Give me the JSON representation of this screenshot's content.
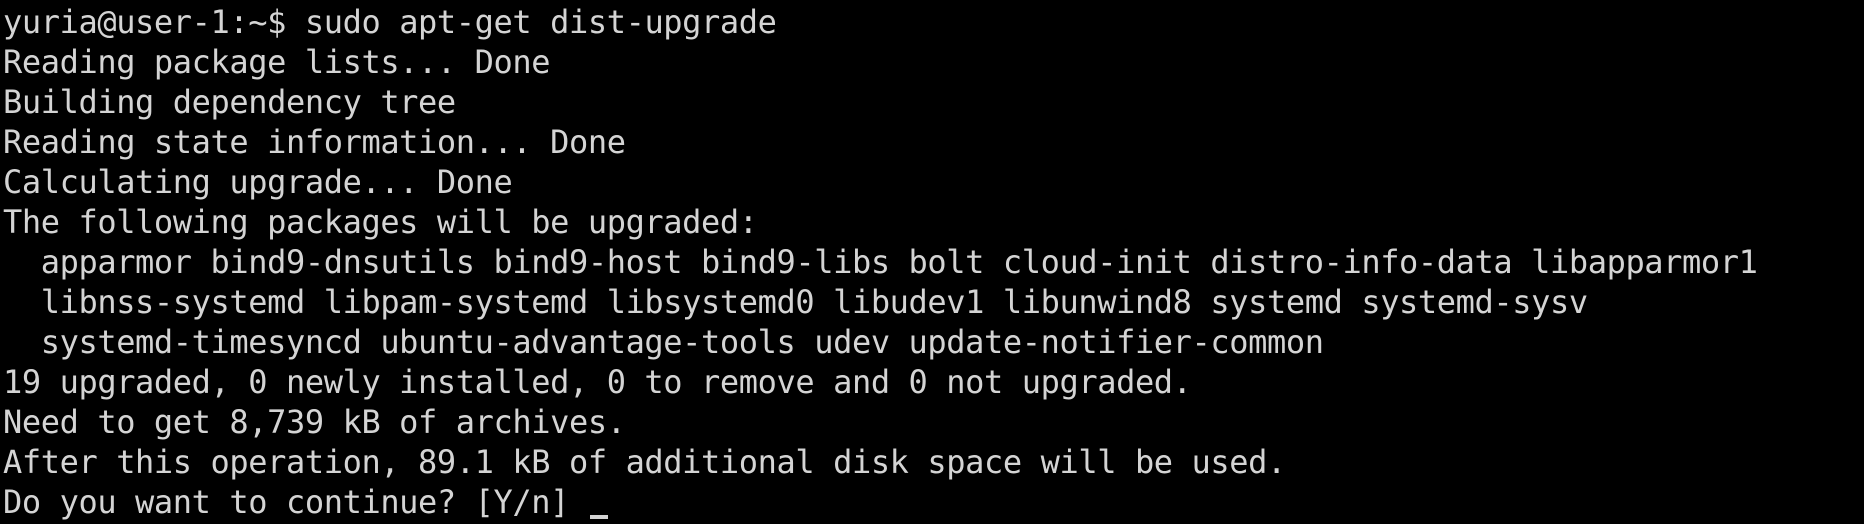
{
  "terminal": {
    "prompt": "yuria@user-1:~$ ",
    "command": "sudo apt-get dist-upgrade",
    "output": [
      "Reading package lists... Done",
      "Building dependency tree",
      "Reading state information... Done",
      "Calculating upgrade... Done",
      "The following packages will be upgraded:",
      "  apparmor bind9-dnsutils bind9-host bind9-libs bolt cloud-init distro-info-data libapparmor1",
      "  libnss-systemd libpam-systemd libsystemd0 libudev1 libunwind8 systemd systemd-sysv",
      "  systemd-timesyncd ubuntu-advantage-tools udev update-notifier-common",
      "19 upgraded, 0 newly installed, 0 to remove and 0 not upgraded.",
      "Need to get 8,739 kB of archives.",
      "After this operation, 89.1 kB of additional disk space will be used."
    ],
    "question": "Do you want to continue? [Y/n] "
  }
}
